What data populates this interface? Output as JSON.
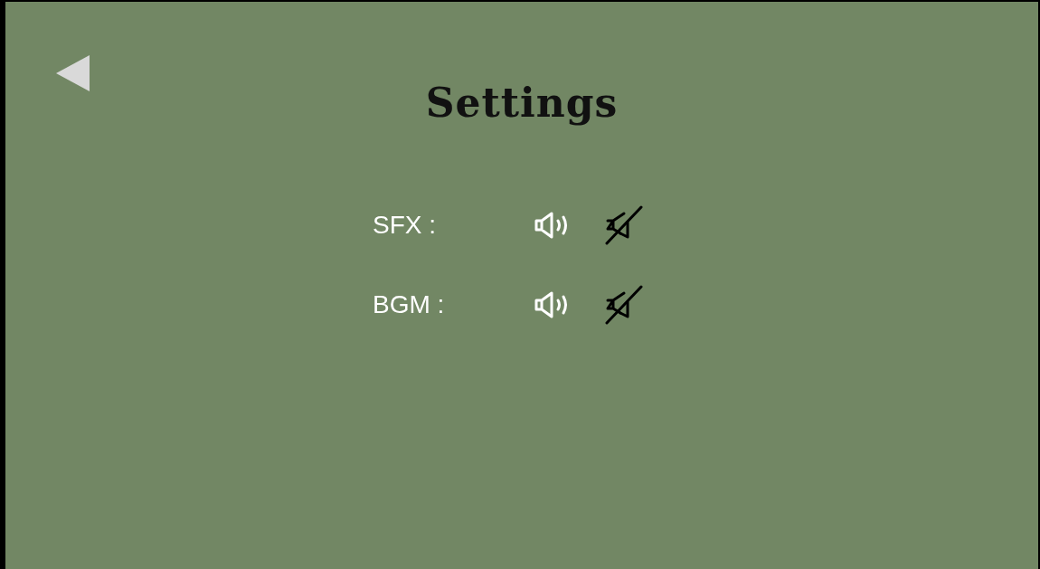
{
  "title": "Settings",
  "rows": [
    {
      "label": "SFX :",
      "options": [
        {
          "kind": "sound_on",
          "selected": true
        },
        {
          "kind": "sound_off",
          "selected": false
        }
      ]
    },
    {
      "label": "BGM :",
      "options": [
        {
          "kind": "sound_on",
          "selected": true
        },
        {
          "kind": "sound_off",
          "selected": false
        }
      ]
    }
  ]
}
